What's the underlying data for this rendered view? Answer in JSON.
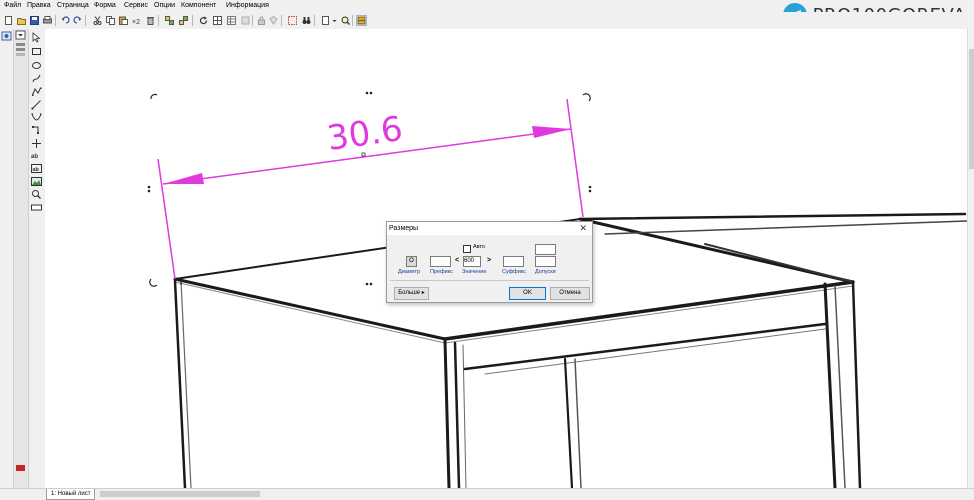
{
  "menu": [
    "Файл",
    "Правка",
    "Страница",
    "Форма",
    "Сервис",
    "Опции",
    "Компонент",
    "Информация"
  ],
  "brand": {
    "text": "PRO100GOREVA"
  },
  "drawing": {
    "dimension_value": "30.6",
    "dimension_color": "#e03adf"
  },
  "dialog": {
    "title": "Размеры",
    "close_label": "✕",
    "auto_label": "Авто",
    "diameter_symbol": "O",
    "value_left_bracket": "<",
    "value_right_bracket": ">",
    "value": "600",
    "prefix_value": "",
    "suffix_value": "",
    "tolerance_upper": "",
    "tolerance_lower": "",
    "labels": {
      "diameter": "Диаметр",
      "prefix": "Префикс",
      "value": "Значение",
      "suffix": "Суффикс",
      "tolerance": "Допуски"
    },
    "more_button": "Больше ▸",
    "ok_button": "OK",
    "cancel_button": "Отмена"
  },
  "sheet_tab": "1: Новый лист"
}
